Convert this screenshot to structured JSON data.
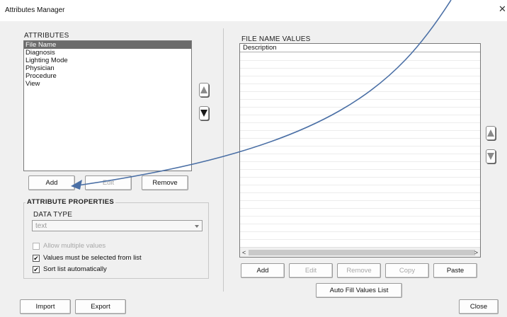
{
  "window": {
    "title": "Attributes Manager",
    "close_glyph": "✕"
  },
  "attributes": {
    "label": "ATTRIBUTES",
    "items": [
      "File Name",
      "Diagnosis",
      "Lighting Mode",
      "Physician",
      "Procedure",
      "View"
    ],
    "selected_index": 0,
    "add_label": "Add",
    "edit_label": "Edit",
    "remove_label": "Remove",
    "move_up_icon": "up-arrow-icon",
    "move_down_icon": "down-arrow-icon"
  },
  "attribute_properties": {
    "title": "ATTRIBUTE PROPERTIES",
    "data_type_label": "DATA TYPE",
    "data_type_value": "text",
    "allow_multiple_label": "Allow multiple values",
    "allow_multiple_checked": false,
    "must_select_label": "Values must be selected from list",
    "must_select_checked": true,
    "sort_list_label": "Sort list automatically",
    "sort_list_checked": true,
    "check_glyph": "✔"
  },
  "values": {
    "label": "FILE NAME VALUES",
    "column_header": "Description",
    "scroll_left": "<",
    "scroll_right": ">",
    "add_label": "Add",
    "edit_label": "Edit",
    "remove_label": "Remove",
    "copy_label": "Copy",
    "paste_label": "Paste",
    "auto_fill_label": "Auto Fill Values List"
  },
  "footer": {
    "import_label": "Import",
    "export_label": "Export",
    "close_label": "Close"
  },
  "colors": {
    "selection": "#6b6b6b",
    "annotation_arrow": "#4a6fa5"
  }
}
